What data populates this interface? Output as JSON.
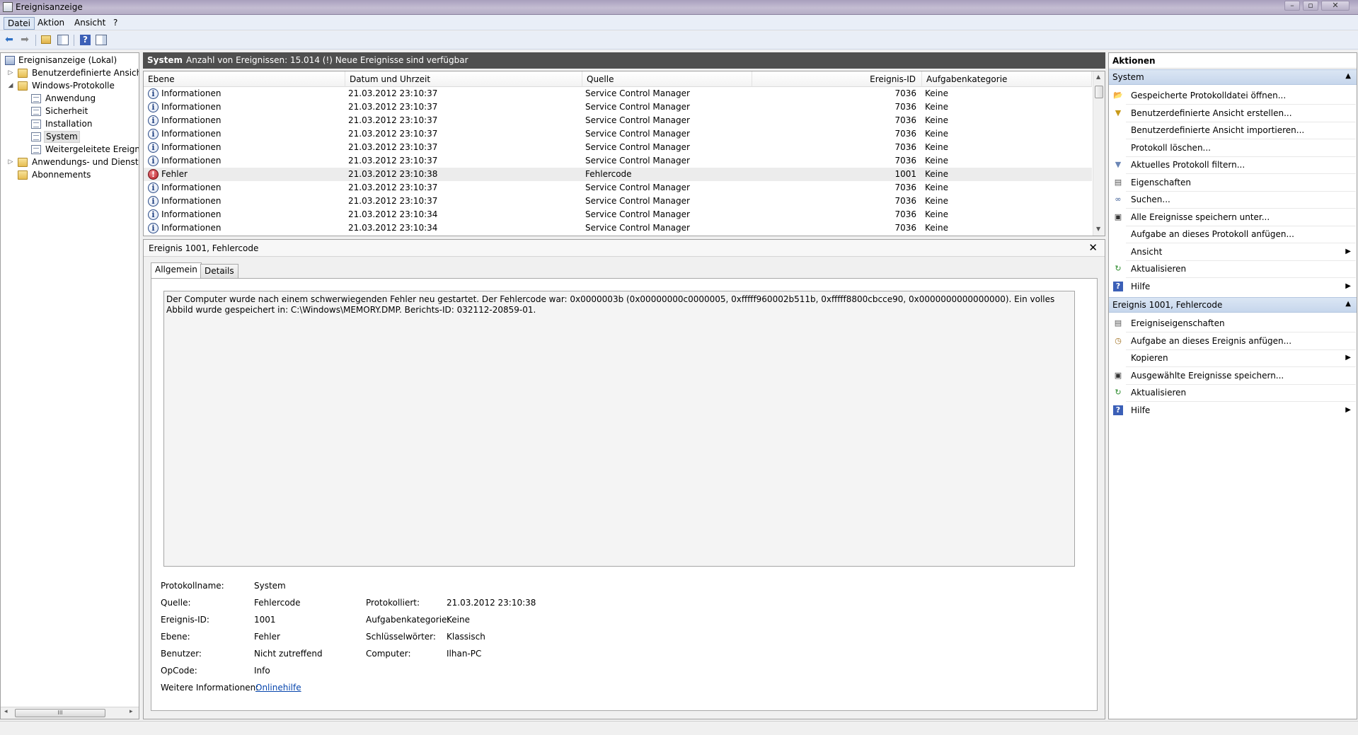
{
  "window": {
    "title": "Ereignisanzeige"
  },
  "menu": [
    {
      "label": "Datei"
    },
    {
      "label": "Aktion"
    },
    {
      "label": "Ansicht"
    },
    {
      "label": "?"
    }
  ],
  "tree": {
    "root": "Ereignisanzeige (Lokal)",
    "custom_views": "Benutzerdefinierte Ansichten",
    "windows_logs": "Windows-Protokolle",
    "logs": [
      "Anwendung",
      "Sicherheit",
      "Installation",
      "System",
      "Weitergeleitete Ereignisse"
    ],
    "app_services": "Anwendungs- und Dienstprotokolle",
    "subscriptions": "Abonnements",
    "scroll_grip": "III"
  },
  "center": {
    "log_name": "System",
    "summary": "Anzahl von Ereignissen: 15.014 (!) Neue Ereignisse sind verfügbar"
  },
  "grid": {
    "columns": [
      "Ebene",
      "Datum und Uhrzeit",
      "Quelle",
      "Ereignis-ID",
      "Aufgabenkategorie"
    ],
    "rows": [
      {
        "level": "Informationen",
        "date": "21.03.2012 23:10:37",
        "source": "Service Control Manager",
        "id": "7036",
        "category": "Keine",
        "type": "info"
      },
      {
        "level": "Informationen",
        "date": "21.03.2012 23:10:37",
        "source": "Service Control Manager",
        "id": "7036",
        "category": "Keine",
        "type": "info"
      },
      {
        "level": "Informationen",
        "date": "21.03.2012 23:10:37",
        "source": "Service Control Manager",
        "id": "7036",
        "category": "Keine",
        "type": "info"
      },
      {
        "level": "Informationen",
        "date": "21.03.2012 23:10:37",
        "source": "Service Control Manager",
        "id": "7036",
        "category": "Keine",
        "type": "info"
      },
      {
        "level": "Informationen",
        "date": "21.03.2012 23:10:37",
        "source": "Service Control Manager",
        "id": "7036",
        "category": "Keine",
        "type": "info"
      },
      {
        "level": "Informationen",
        "date": "21.03.2012 23:10:37",
        "source": "Service Control Manager",
        "id": "7036",
        "category": "Keine",
        "type": "info"
      },
      {
        "level": "Fehler",
        "date": "21.03.2012 23:10:38",
        "source": "Fehlercode",
        "id": "1001",
        "category": "Keine",
        "type": "error"
      },
      {
        "level": "Informationen",
        "date": "21.03.2012 23:10:37",
        "source": "Service Control Manager",
        "id": "7036",
        "category": "Keine",
        "type": "info"
      },
      {
        "level": "Informationen",
        "date": "21.03.2012 23:10:37",
        "source": "Service Control Manager",
        "id": "7036",
        "category": "Keine",
        "type": "info"
      },
      {
        "level": "Informationen",
        "date": "21.03.2012 23:10:34",
        "source": "Service Control Manager",
        "id": "7036",
        "category": "Keine",
        "type": "info"
      },
      {
        "level": "Informationen",
        "date": "21.03.2012 23:10:34",
        "source": "Service Control Manager",
        "id": "7036",
        "category": "Keine",
        "type": "info"
      }
    ]
  },
  "detail": {
    "title": "Ereignis 1001, Fehlercode",
    "tabs": [
      "Allgemein",
      "Details"
    ],
    "description": "Der Computer wurde nach einem schwerwiegenden Fehler neu gestartet. Der Fehlercode war: 0x0000003b (0x00000000c0000005, 0xfffff960002b511b, 0xfffff8800cbcce90, 0x0000000000000000). Ein volles Abbild wurde gespeichert in: C:\\Windows\\MEMORY.DMP. Berichts-ID: 032112-20859-01.",
    "props": {
      "log_name_label": "Protokollname:",
      "log_name": "System",
      "source_label": "Quelle:",
      "source": "Fehlercode",
      "event_id_label": "Ereignis-ID:",
      "event_id": "1001",
      "level_label": "Ebene:",
      "level": "Fehler",
      "user_label": "Benutzer:",
      "user": "Nicht zutreffend",
      "opcode_label": "OpCode:",
      "opcode": "Info",
      "more_info_label": "Weitere Informationen:",
      "more_info_link": "Onlinehilfe",
      "logged_label": "Protokolliert:",
      "logged": "21.03.2012 23:10:38",
      "task_category_label": "Aufgabenkategorie:",
      "task_category": "Keine",
      "keywords_label": "Schlüsselwörter:",
      "keywords": "Klassisch",
      "computer_label": "Computer:",
      "computer": "Ilhan-PC"
    }
  },
  "actions": {
    "title": "Aktionen",
    "section1": "System",
    "items1": [
      {
        "label": "Gespeicherte Protokolldatei öffnen...",
        "icon": "open-folder-icon"
      },
      {
        "label": "Benutzerdefinierte Ansicht erstellen...",
        "icon": "filter-create-icon"
      },
      {
        "label": "Benutzerdefinierte Ansicht importieren...",
        "icon": ""
      },
      {
        "label": "Protokoll löschen...",
        "icon": ""
      },
      {
        "label": "Aktuelles Protokoll filtern...",
        "icon": "filter-icon"
      },
      {
        "label": "Eigenschaften",
        "icon": "properties-icon"
      },
      {
        "label": "Suchen...",
        "icon": "binoculars-icon"
      },
      {
        "label": "Alle Ereignisse speichern unter...",
        "icon": "save-icon"
      },
      {
        "label": "Aufgabe an dieses Protokoll anfügen...",
        "icon": ""
      },
      {
        "label": "Ansicht",
        "icon": "",
        "submenu": true
      },
      {
        "label": "Aktualisieren",
        "icon": "refresh-icon"
      },
      {
        "label": "Hilfe",
        "icon": "help-icon",
        "submenu": true
      }
    ],
    "section2": "Ereignis 1001, Fehlercode",
    "items2": [
      {
        "label": "Ereigniseigenschaften",
        "icon": "properties-icon"
      },
      {
        "label": "Aufgabe an dieses Ereignis anfügen...",
        "icon": "task-icon"
      },
      {
        "label": "Kopieren",
        "icon": "",
        "submenu": true
      },
      {
        "label": "Ausgewählte Ereignisse speichern...",
        "icon": "save-icon"
      },
      {
        "label": "Aktualisieren",
        "icon": "refresh-icon"
      },
      {
        "label": "Hilfe",
        "icon": "help-icon",
        "submenu": true
      }
    ]
  }
}
